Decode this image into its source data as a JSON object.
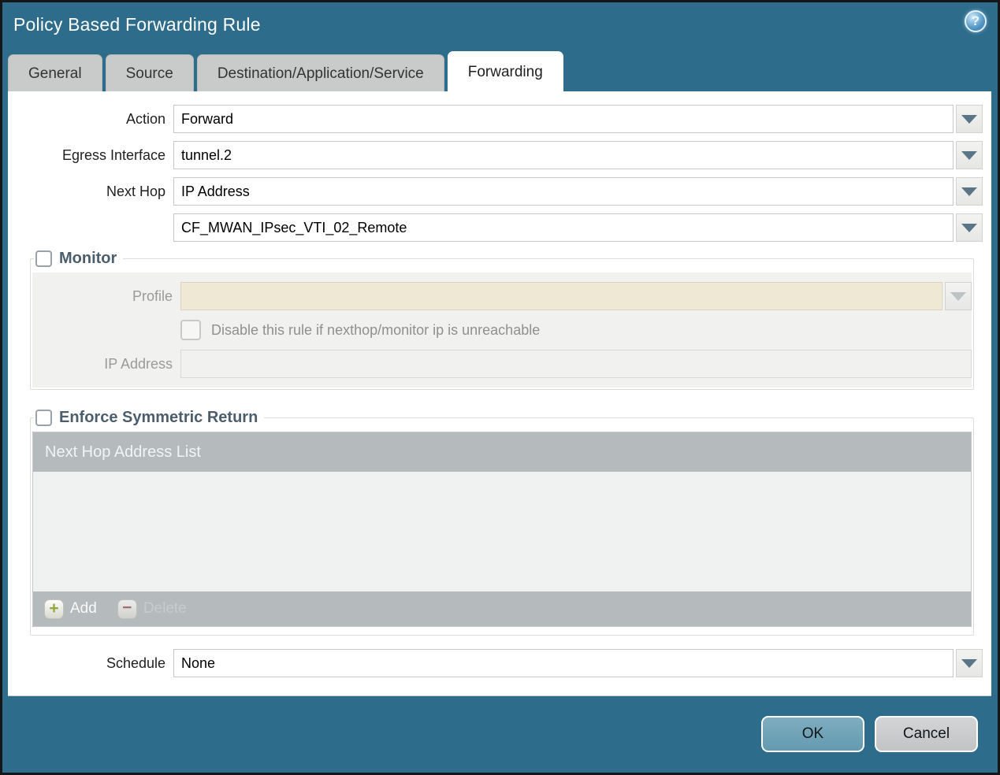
{
  "window": {
    "title": "Policy Based Forwarding Rule",
    "help_glyph": "?"
  },
  "tabs": [
    {
      "label": "General",
      "active": false
    },
    {
      "label": "Source",
      "active": false
    },
    {
      "label": "Destination/Application/Service",
      "active": false
    },
    {
      "label": "Forwarding",
      "active": true
    }
  ],
  "form": {
    "action": {
      "label": "Action",
      "value": "Forward"
    },
    "egress_interface": {
      "label": "Egress Interface",
      "value": "tunnel.2"
    },
    "next_hop": {
      "label": "Next Hop",
      "value": "IP Address"
    },
    "next_hop_address": {
      "value": "CF_MWAN_IPsec_VTI_02_Remote"
    },
    "schedule": {
      "label": "Schedule",
      "value": "None"
    }
  },
  "monitor": {
    "title": "Monitor",
    "checked": false,
    "profile": {
      "label": "Profile",
      "value": ""
    },
    "disable_rule_checkbox": {
      "label": "Disable this rule if nexthop/monitor ip is unreachable",
      "checked": false
    },
    "ip_address": {
      "label": "IP Address",
      "value": ""
    }
  },
  "enforce_symmetric_return": {
    "title": "Enforce Symmetric Return",
    "checked": false,
    "table": {
      "header": "Next Hop Address List",
      "rows": []
    },
    "add_label": "Add",
    "delete_label": "Delete",
    "add_glyph": "+",
    "delete_glyph": "−"
  },
  "footer": {
    "ok_label": "OK",
    "cancel_label": "Cancel"
  },
  "colors": {
    "titlebar_teal": "#2e6c8c",
    "active_tab": "#ffffff",
    "inactive_tab": "#c9cbcb",
    "table_header_gray": "#b5babc",
    "monitor_disabled_field_beige": "#eee8d5",
    "ok_button": "#6fa1b5",
    "cancel_button": "#c8cacc",
    "legend_text": "#4c5e6b"
  }
}
